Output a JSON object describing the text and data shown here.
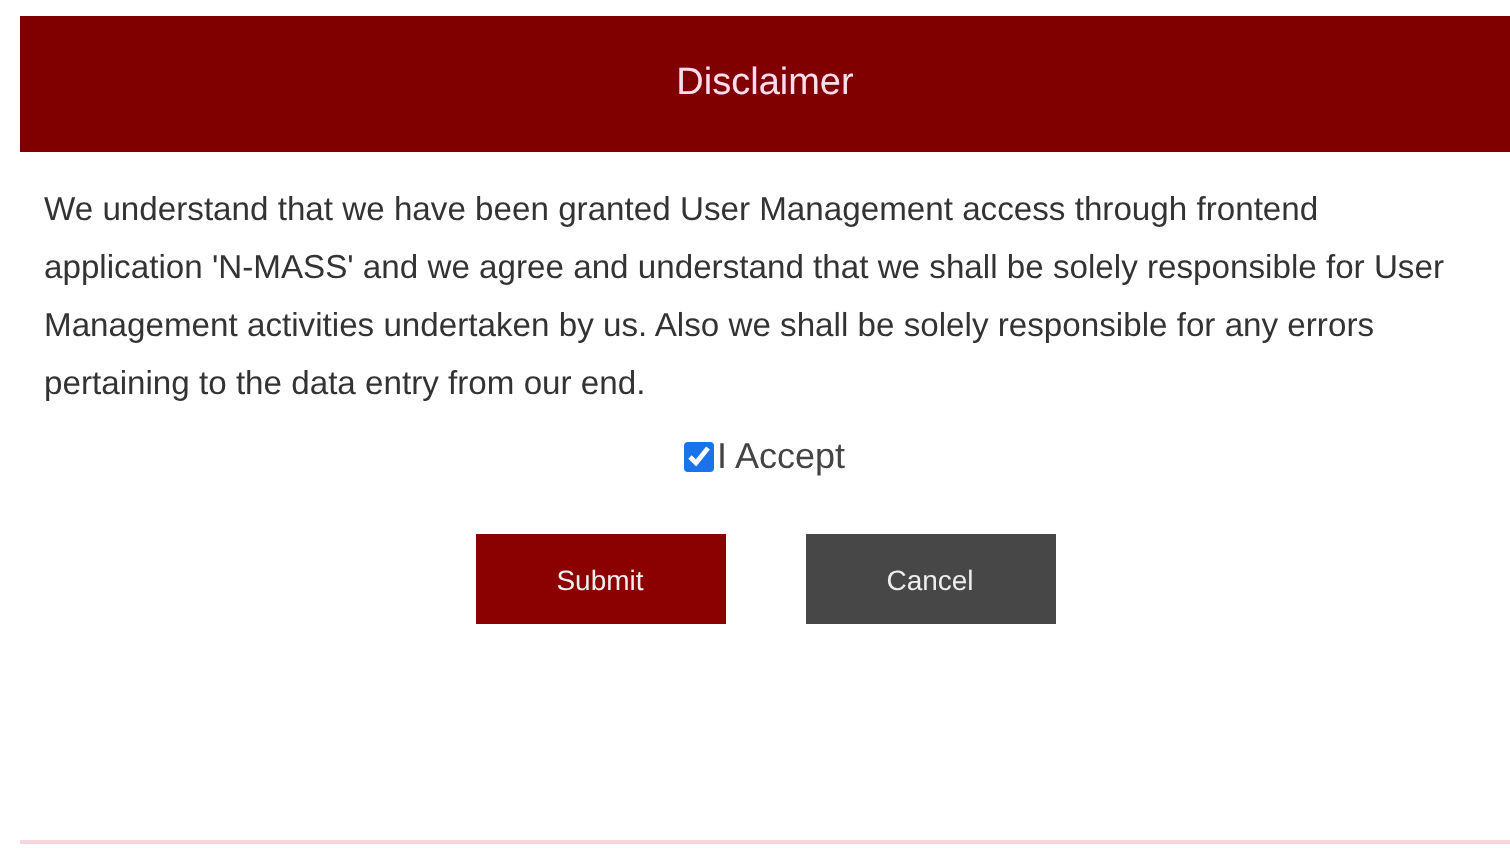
{
  "dialog": {
    "title": "Disclaimer",
    "message": "We understand that we have been granted User Management access through frontend application 'N-MASS' and we agree and understand that we shall be solely responsible for User Management activities undertaken by us. Also we shall be solely responsible for any errors pertaining to the data entry from our end.",
    "accept": {
      "label": "I Accept",
      "checked": true
    },
    "buttons": [
      {
        "label": "Submit",
        "kind": "primary"
      },
      {
        "label": "Cancel",
        "kind": "secondary"
      }
    ]
  }
}
